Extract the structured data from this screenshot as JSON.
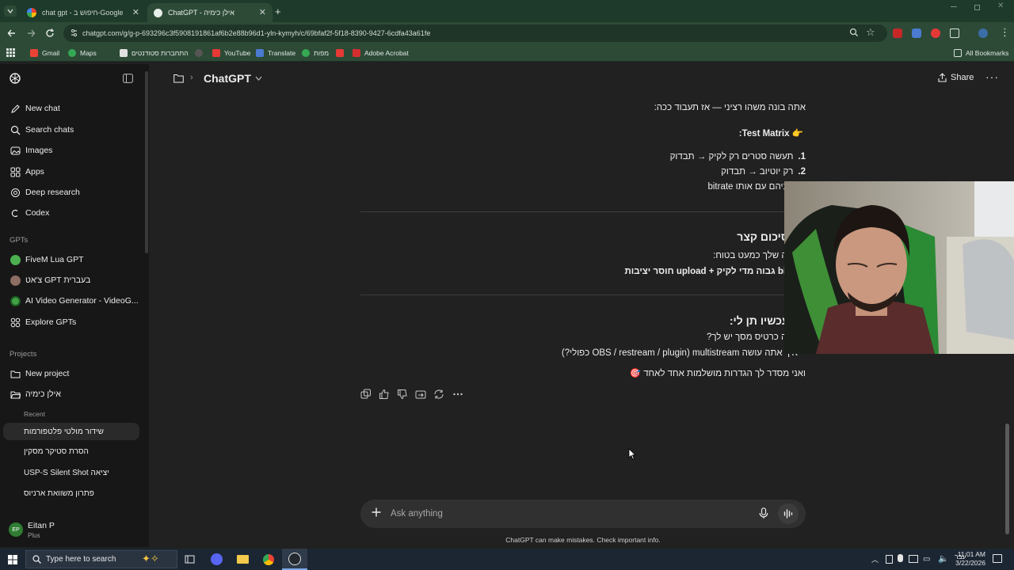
{
  "browser": {
    "tabs": [
      {
        "title": "chat gpt - חיפוש ב-Google",
        "active": false
      },
      {
        "title": "ChatGPT - אילן כימיה",
        "active": true
      }
    ],
    "url": "chatgpt.com/g/g-p-693296c3f5908191861af6b2e88b96d1-yln-kymyh/c/69bfaf2f-5f18-8390-9427-6cdfa43a61fe",
    "bookmarks": [
      "Gmail",
      "Maps",
      "התחברות סטודנטים",
      "YouTube",
      "Translate",
      "מפות",
      "Adobe Acrobat"
    ],
    "all_bookmarks": "All Bookmarks"
  },
  "sidebar": {
    "nav": [
      {
        "label": "New chat",
        "icon": "edit-icon"
      },
      {
        "label": "Search chats",
        "icon": "search-icon"
      },
      {
        "label": "Images",
        "icon": "image-icon"
      },
      {
        "label": "Apps",
        "icon": "apps-icon"
      },
      {
        "label": "Deep research",
        "icon": "research-icon"
      },
      {
        "label": "Codex",
        "icon": "codex-icon"
      }
    ],
    "gpts_label": "GPTs",
    "gpts": [
      {
        "label": "FiveM Lua GPT",
        "color": "#4caf50"
      },
      {
        "label": "צ'אט GPT בעברית",
        "color": "#8d6e63"
      },
      {
        "label": "AI Video Generator - VideoG...",
        "color": "#43a047"
      },
      {
        "label": "Explore GPTs",
        "color": ""
      }
    ],
    "projects_label": "Projects",
    "projects": [
      {
        "label": "New project"
      },
      {
        "label": "אילן כימיה"
      }
    ],
    "recent_label": "Recent",
    "recent": [
      "שידור מולטי פלטפורמות",
      "הסרת סטיקר מסקין",
      "USP-S Silent Shot יציאה",
      "פתרון משוואת ארניוס"
    ],
    "user": {
      "name": "Eitan P",
      "plan": "Plus",
      "initials": "EP"
    }
  },
  "header": {
    "title": "ChatGPT",
    "share": "Share"
  },
  "conversation": {
    "line1": "אתה בונה משהו רציני — אז תעבוד ככה:",
    "matrix_title": "Test Matrix:",
    "matrix_items": [
      {
        "num": "1.",
        "text": "תעשה סטרים רק לקיק → תבדוק"
      },
      {
        "num": "2.",
        "text": "רק יוטיוב → תבדוק"
      },
      {
        "num": "3.",
        "text": "שניהם עם אותו bitrate"
      }
    ],
    "summary_title": "סיכום קצר",
    "summary_line1": "הבעיה שלך כמעט בטוח:",
    "summary_line2": "bitrate גבוה מדי לקיק + upload חוסר יציבות",
    "ask_title": "עכשיו תן לי:",
    "ask_items": [
      "איזה כרטיס מסך יש לך?",
      "איך אתה עושה multistream (OBS / restream / plugin כפולי?)"
    ],
    "closing": "ואני מסדר לך הגדרות מושלמות אחד לאחד"
  },
  "composer": {
    "placeholder": "Ask anything"
  },
  "disclaimer": "ChatGPT can make mistakes. Check important info.",
  "taskbar": {
    "search": "Type here to search",
    "lang": "עבר",
    "time": "11:01 AM",
    "date": "3/22/2026"
  }
}
